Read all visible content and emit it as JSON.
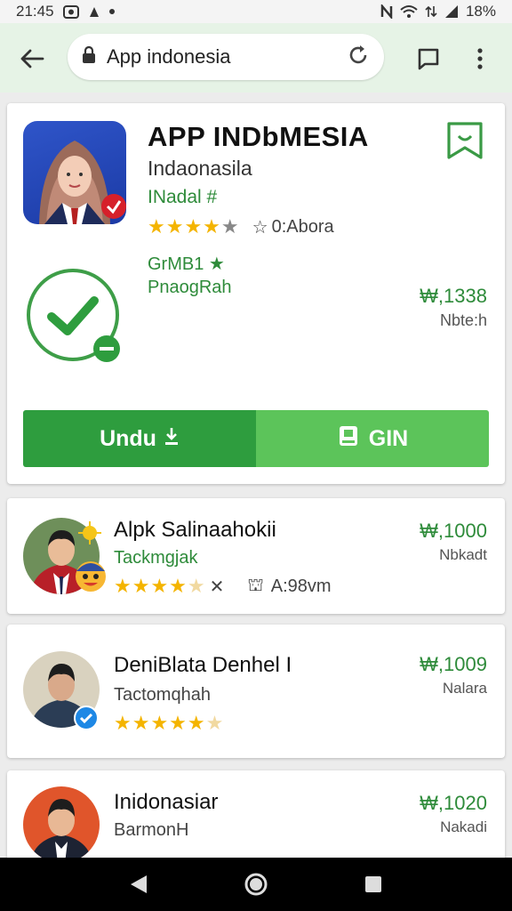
{
  "status": {
    "time": "21:45",
    "battery": "18%"
  },
  "browser": {
    "url": "App indonesia"
  },
  "main": {
    "title": "APP INDbMESIA",
    "subtitle": "Indaonasila",
    "tag": "INadal #",
    "rating_value": 3.5,
    "rating_extra": "0:Abora",
    "meta1": "GrMB1",
    "meta2": "PnaogRah",
    "price": "₩,1338",
    "price_note": "Nbte:h",
    "btn_download": "Undu",
    "btn_gin": "GIN"
  },
  "list": [
    {
      "title": "Alpk Salinaahokii",
      "sub": "Tackmgjak",
      "rating_value": 4,
      "rating_extra": "A:98vm",
      "price": "₩,1000",
      "note": "Nbkadt"
    },
    {
      "title": "DeniBlata Denhel I",
      "sub": "Tactomqhah",
      "rating_value": 5,
      "price": "₩,1009",
      "note": "Nalara"
    },
    {
      "title": "Inidonasiar",
      "sub": "BarmonH",
      "price": "₩,1020",
      "note": "Nakadi"
    }
  ],
  "colors": {
    "accent": "#2e9d3e",
    "accent_light": "#5cc45a",
    "star": "#f4b400",
    "browser_bg": "#e6f3e6"
  }
}
